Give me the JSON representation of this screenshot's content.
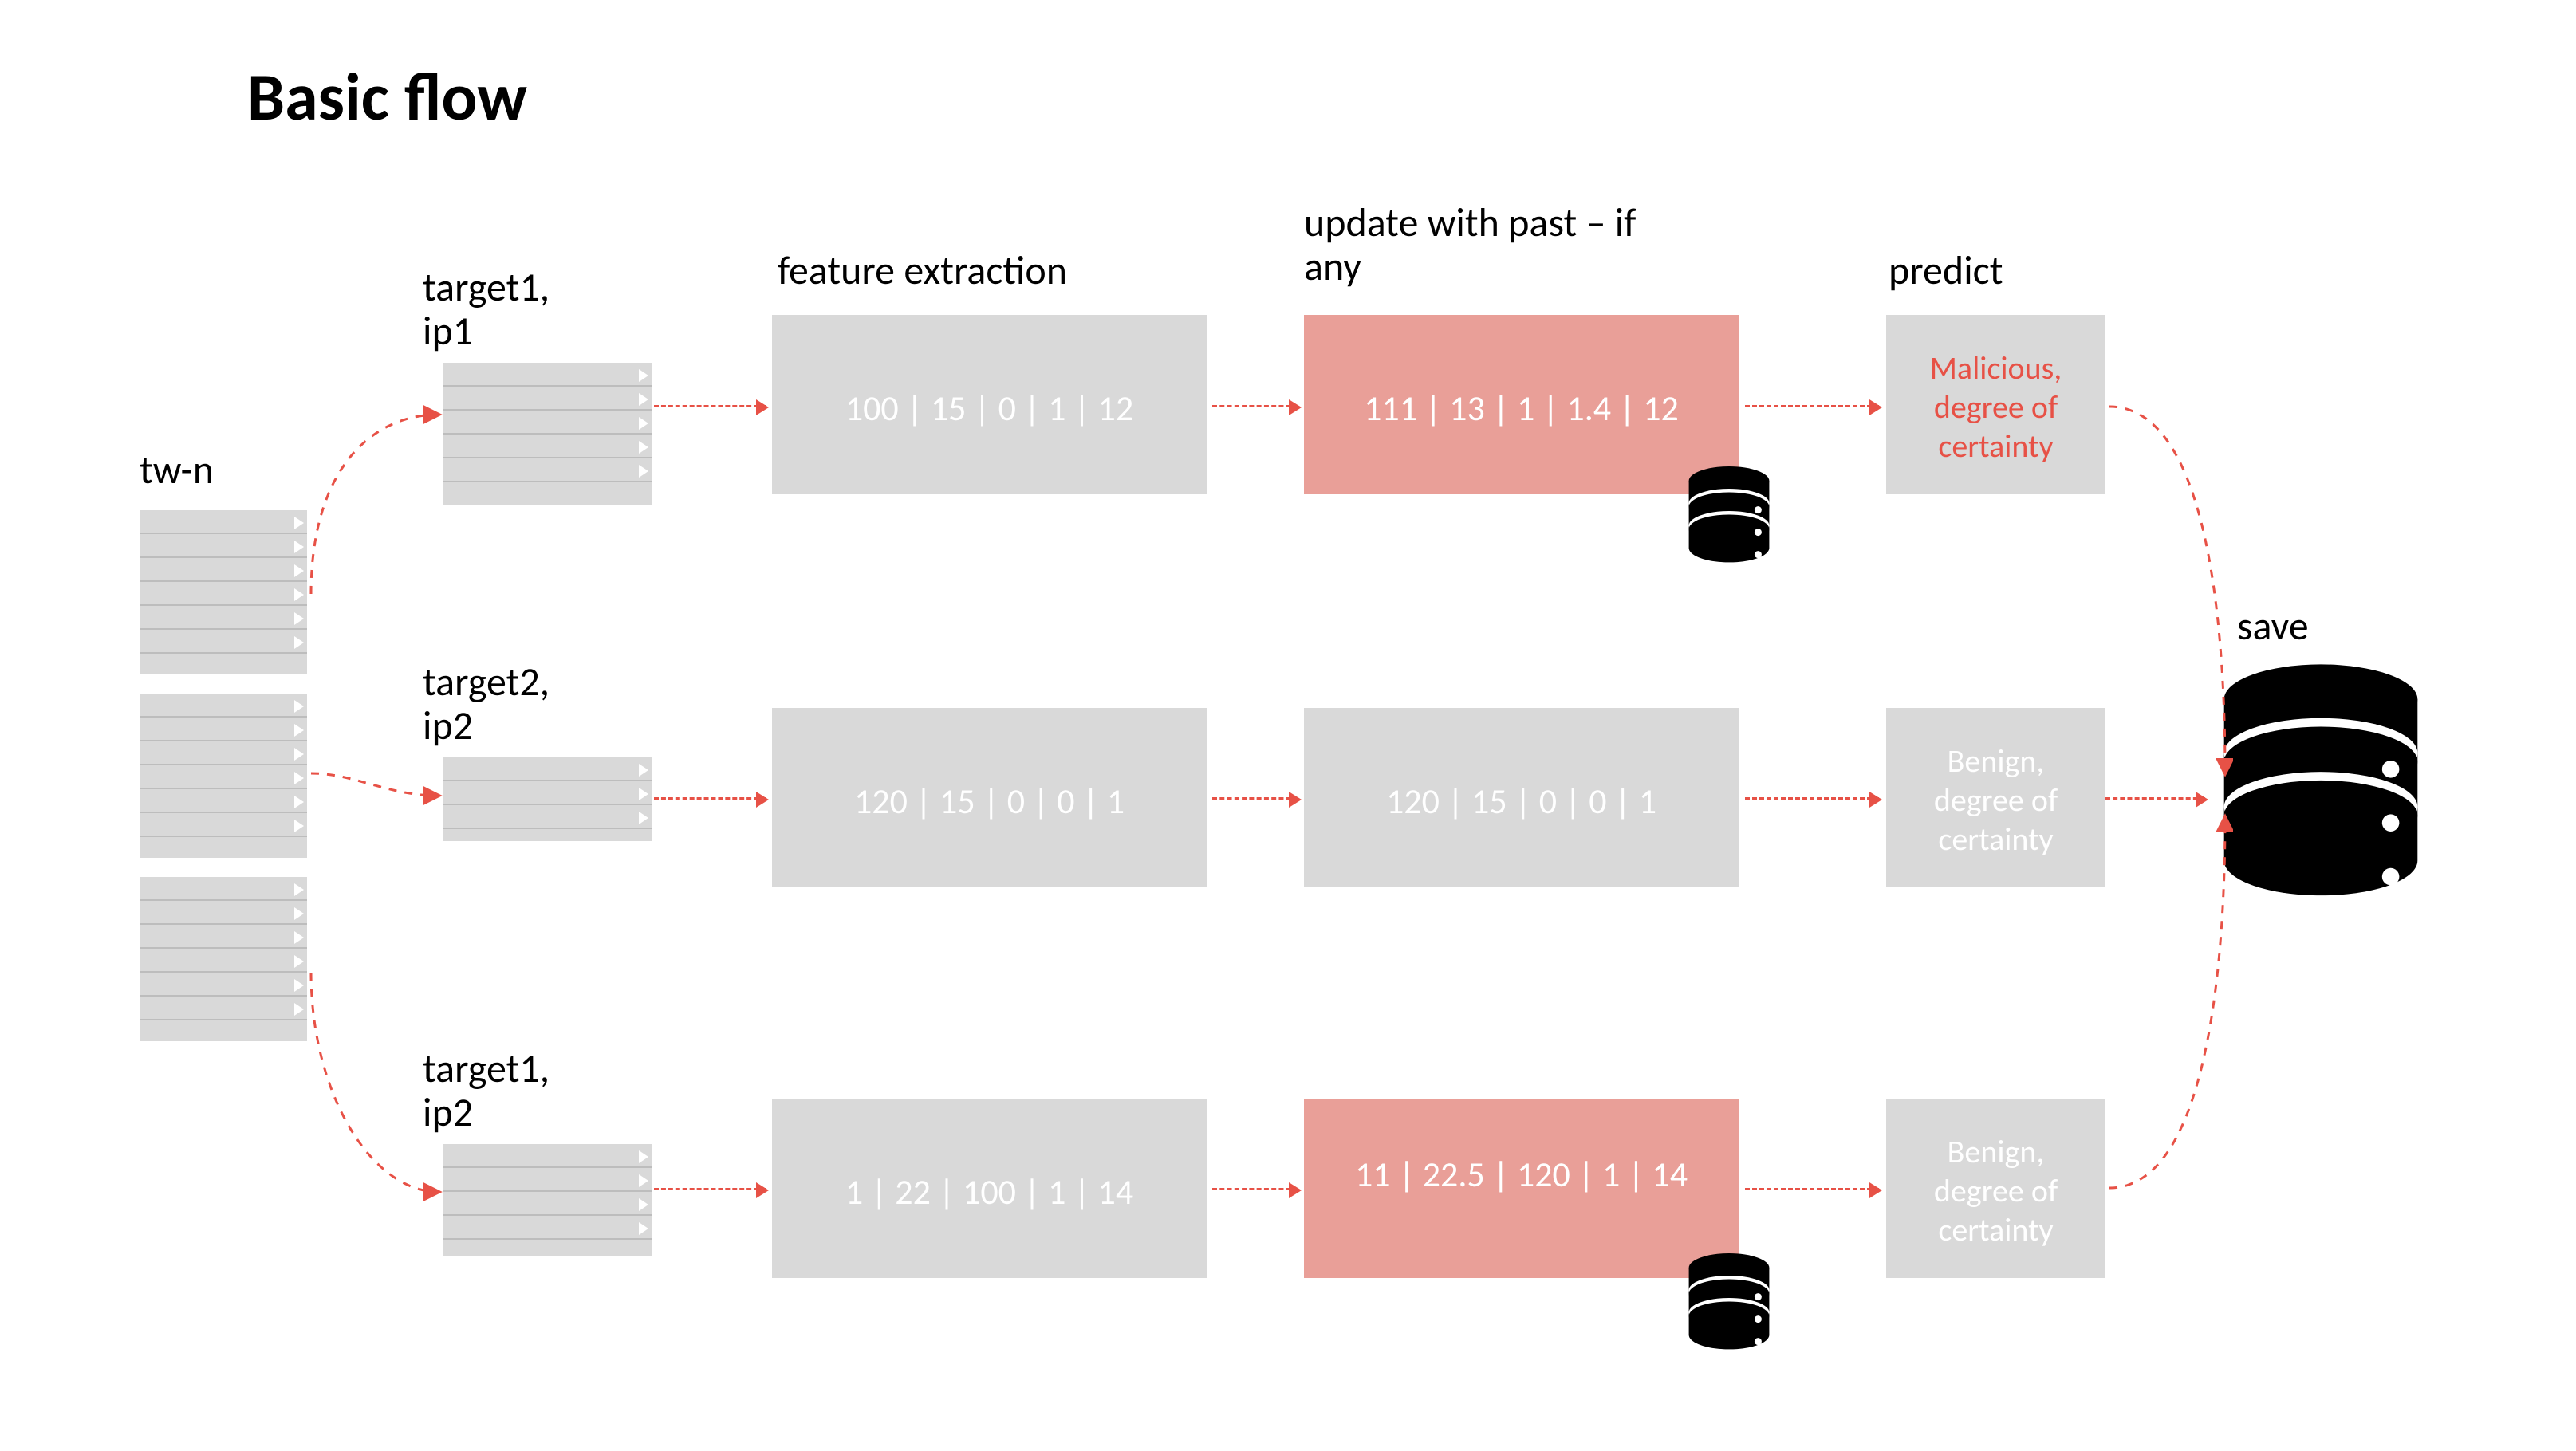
{
  "title": "Basic flow",
  "source_label": "tw-n",
  "col_headers": {
    "feature": "feature extraction",
    "update": "update with past – if any",
    "predict": "predict",
    "save": "save"
  },
  "rows": [
    {
      "target": "target1, ip1",
      "feature": "100 | 15 | 0 | 1 | 12",
      "update": "111 | 13 | 1 | 1.4 | 12",
      "update_red": true,
      "predict": "Malicious, degree of certainty",
      "predict_red": true
    },
    {
      "target": "target2, ip2",
      "feature": "120 | 15 | 0 | 0 | 1",
      "update": "120 | 15 | 0 | 0 | 1",
      "update_red": false,
      "predict": "Benign, degree of certainty",
      "predict_red": false
    },
    {
      "target": "target1, ip2",
      "feature": "1 | 22 | 100 | 1 | 14",
      "update": "11 | 22.5 | 120 | 1 | 14",
      "update_red": true,
      "predict": "Benign, degree of certainty",
      "predict_red": false
    }
  ]
}
